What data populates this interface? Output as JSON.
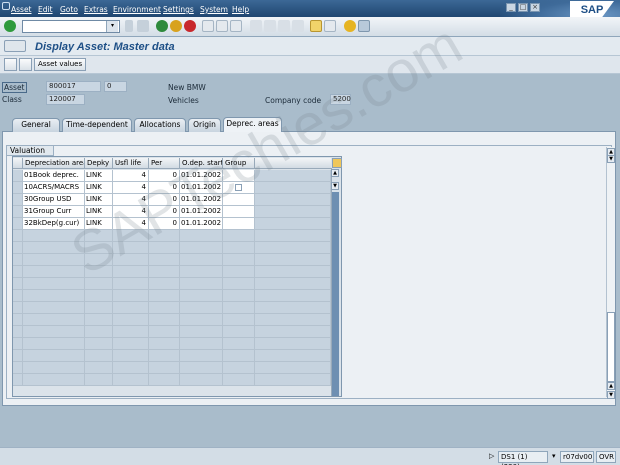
{
  "menubar": {
    "items": [
      "Asset",
      "Edit",
      "Goto",
      "Extras",
      "Environment",
      "Settings",
      "System",
      "Help"
    ],
    "logo": "SAP"
  },
  "toolbar": {
    "command_value": ""
  },
  "title": "Display Asset: Master data",
  "app_toolbar": {
    "asset_values_label": "Asset values"
  },
  "header": {
    "asset_label": "Asset",
    "asset_number": "800017",
    "sub_number": "0",
    "asset_description": "New BMW",
    "class_label": "Class",
    "class_value": "120007",
    "class_description": "Vehicles",
    "company_code_label": "Company code",
    "company_code_value": "5200"
  },
  "tabs": [
    "General",
    "Time-dependent",
    "Allocations",
    "Origin",
    "Deprec. areas"
  ],
  "active_tab": "Deprec. areas",
  "valuation": {
    "title": "Valuation",
    "columns": [
      "Depreciation area",
      "Depky",
      "Usfl life",
      "Per",
      "O.dep. start",
      "Group"
    ],
    "rows": [
      {
        "area": "01",
        "name": "Book deprec.",
        "depky": "LINK",
        "life": "4",
        "per": "0",
        "start": "01.01.2002",
        "group": false
      },
      {
        "area": "10",
        "name": "ACRS/MACRS",
        "depky": "LINK",
        "life": "4",
        "per": "0",
        "start": "01.01.2002",
        "group": true
      },
      {
        "area": "30",
        "name": "Group USD",
        "depky": "LINK",
        "life": "4",
        "per": "0",
        "start": "01.01.2002",
        "group": false
      },
      {
        "area": "31",
        "name": "Group Curr",
        "depky": "LINK",
        "life": "4",
        "per": "0",
        "start": "01.01.2002",
        "group": false
      },
      {
        "area": "32",
        "name": "BkDep(g.cur)",
        "depky": "LINK",
        "life": "4",
        "per": "0",
        "start": "01.01.2002",
        "group": false
      }
    ],
    "empty_rows": 13
  },
  "statusbar": {
    "session": "DS1 (1) (230)",
    "server": "r07dv00",
    "mode": "OVR"
  },
  "watermark": "SAPTechies.com",
  "colors": {
    "menubar": "#2b5785",
    "title": "#1d4f86",
    "background": "#a9bccb"
  }
}
